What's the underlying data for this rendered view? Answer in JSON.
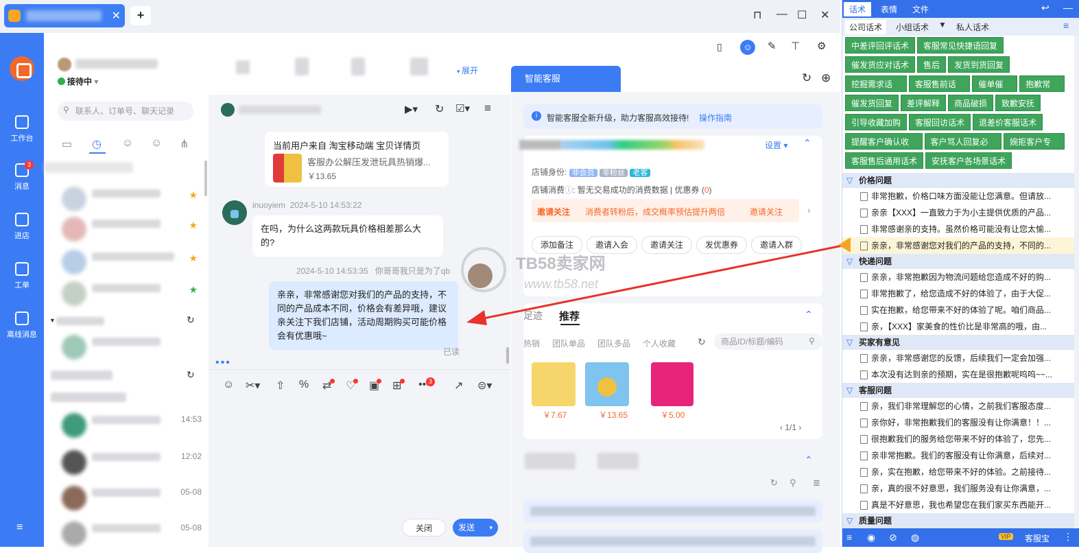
{
  "window": {
    "controls": [
      "⊓",
      "—",
      "☐",
      "✕"
    ]
  },
  "tab": {
    "close": "✕",
    "new": "+"
  },
  "nav": {
    "items": [
      {
        "label": "工作台"
      },
      {
        "label": "消息",
        "badge": "3"
      },
      {
        "label": "进店"
      },
      {
        "label": "工单"
      },
      {
        "label": "离线消息"
      }
    ],
    "menu": "≡"
  },
  "status": {
    "label": "接待中",
    "arrow": "▾"
  },
  "expand": "展开",
  "search": {
    "placeholder": "联系人、订单号、聊天记录"
  },
  "contacts": {
    "times": [
      "14:53",
      "12:02",
      "05-08",
      "05-08"
    ]
  },
  "chat": {
    "source_label": "当前用户来自 淘宝移动端 宝贝详情页",
    "product_title": "客服办公解压发泄玩具热销爆...",
    "product_price": "￥13.65",
    "customer_name": "inuoyiem",
    "customer_time": "2024-5-10 14:53:22",
    "customer_msg": "在吗，为什么这两款玩具价格相差那么大的?",
    "agent_time": "2024-5-10 14:53:35",
    "agent_name": "你哥哥我只是为了qb",
    "agent_msg": "亲亲，非常感谢您对我们的产品的支持，不同的产品成本不同，价格会有差异哦，建议亲关注下我们店铺，活动周期购买可能价格会有优惠哦~",
    "read": "已读",
    "toolbar_badge": "3",
    "close_btn": "关闭",
    "send_btn": "发送",
    "send_arrow": "▾"
  },
  "watermark": {
    "brand": "TB58卖家网",
    "url": "www.tb58.net"
  },
  "smart": {
    "tab": "智能客服",
    "notice": "智能客服全新升级，助力客服高效接待!",
    "notice_link": "操作指南",
    "settings": "设置",
    "shop_identity_label": "店铺身份:",
    "tags": [
      "非会员",
      "非粉丝",
      "老客"
    ],
    "shop_consume_label": "店铺消费",
    "shop_consume_text": "暂无交易成功的消费数据 | 优惠券 (",
    "coupon_count": "0",
    "coupon_close": ")",
    "banner_tag": "邀请关注",
    "banner_text": "消费者转粉后，成交概率预估提升两倍",
    "banner_link": "邀请关注",
    "actions": [
      "添加备注",
      "邀请入会",
      "邀请关注",
      "发优惠券",
      "邀请入群"
    ],
    "rec_tabs": [
      "足迹",
      "推荐"
    ],
    "sub_tabs": [
      "热销",
      "团队单品",
      "团队多品",
      "个人收藏"
    ],
    "search_placeholder": "商品ID/标题/编码",
    "products": [
      {
        "price": "￥7.67"
      },
      {
        "price": "￥13.65"
      },
      {
        "price": "￥5.00"
      }
    ],
    "pager": "1/1"
  },
  "scripts": {
    "top_tabs": [
      "话术",
      "表情",
      "文件"
    ],
    "sub_tabs": [
      "公司话术",
      "小组话术",
      "私人话术"
    ],
    "green_buttons": [
      [
        "中差评回评话术",
        "客服常见快捷语回复"
      ],
      [
        "催发货应对话术",
        "售后",
        "发货到货回复"
      ],
      [
        "挖掘需求话术",
        "客服售前话术",
        "催单催付",
        "抱歉常用"
      ],
      [
        "催发货回复",
        "差评解释",
        "商品破损",
        "致歉安抚"
      ],
      [
        "引导收藏加购",
        "客服回访话术",
        "退差价客服话术"
      ],
      [
        "提醒客户确认收货",
        "客户骂人回复必备",
        "婉拒客户专用"
      ],
      [
        "客服售后通用话术",
        "安抚客户各场景话术"
      ]
    ],
    "sections": [
      {
        "title": "价格问题",
        "items": [
          "非常抱歉，价格口味方面没能让您满意。但请放...",
          "亲亲【XXX】一直致力于为小主提供优质的产品...",
          "非常感谢亲的支持。虽然价格可能没有让您太愉...",
          "亲亲，非常感谢您对我们的产品的支持，不同的..."
        ]
      },
      {
        "title": "快递问题",
        "items": [
          "亲亲，非常抱歉因为物流问题给您造成不好的购...",
          "非常抱歉了，给您造成不好的体验了，由于大促...",
          "实在抱歉，给您带来不好的体验了呢。咱们商品...",
          "亲，【XXX】家美食的性价比是非常高的哦，由..."
        ]
      },
      {
        "title": "买家有意见",
        "items": [
          "亲亲，非常感谢您的反馈，后续我们一定会加强...",
          "本次没有达到亲的预期，实在是很抱歉呢呜呜~~..."
        ]
      },
      {
        "title": "客服问题",
        "items": [
          "亲，我们非常理解您的心情，之前我们客服态度...",
          "亲你好，非常抱歉我们的客服没有让你满意！！...",
          "很抱歉我们的服务给您带来不好的体验了，您先...",
          "亲非常抱歉。我们的客服没有让你满意，后续对...",
          "亲，实在抱歉，给您带来不好的体验。之前接待...",
          "亲，真的很不好意思，我们服务没有让你满意，...",
          "真是不好意思，我也希望您在我们家买东西能开..."
        ]
      },
      {
        "title": "质量问题",
        "items": []
      }
    ],
    "footer_vip": "VIP",
    "footer_label": "客服宝"
  }
}
